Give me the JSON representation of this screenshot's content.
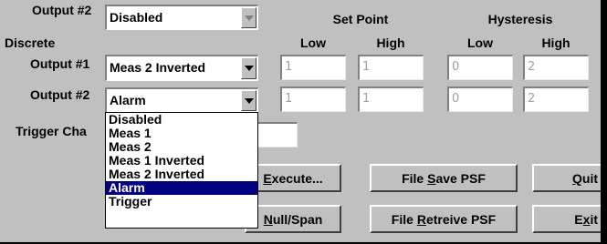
{
  "top_output": {
    "label": "Output #2",
    "value": "Disabled"
  },
  "headers": {
    "set_point": "Set Point",
    "hysteresis": "Hysteresis",
    "low": "Low",
    "high": "High"
  },
  "section_label": "Discrete",
  "rows": [
    {
      "label": "Output #1",
      "value": "Meas 2 Inverted",
      "sp_low": "1",
      "sp_high": "1",
      "hy_low": "0",
      "hy_high": "2"
    },
    {
      "label": "Output #2",
      "value": "Alarm",
      "sp_low": "1",
      "sp_high": "1",
      "hy_low": "0",
      "hy_high": "2"
    }
  ],
  "trigger_label": "Trigger Cha",
  "trigger_value": "",
  "dropdown": {
    "options": [
      "Disabled",
      "Meas 1",
      "Meas 2",
      "Meas 1 Inverted",
      "Meas 2 Inverted",
      "Alarm",
      "Trigger"
    ],
    "selected": "Alarm"
  },
  "buttons": {
    "execute": {
      "pre": "",
      "key": "E",
      "post": "xecute..."
    },
    "file_save": {
      "pre": "File ",
      "key": "S",
      "post": "ave PSF"
    },
    "quit": {
      "pre": "",
      "key": "Q",
      "post": "uit"
    },
    "null_span": {
      "pre": "",
      "key": "N",
      "post": "ull/Span"
    },
    "file_retrieve": {
      "pre": "File ",
      "key": "R",
      "post": "etreive PSF"
    },
    "exit": {
      "pre": "E",
      "key": "x",
      "post": "it"
    }
  }
}
